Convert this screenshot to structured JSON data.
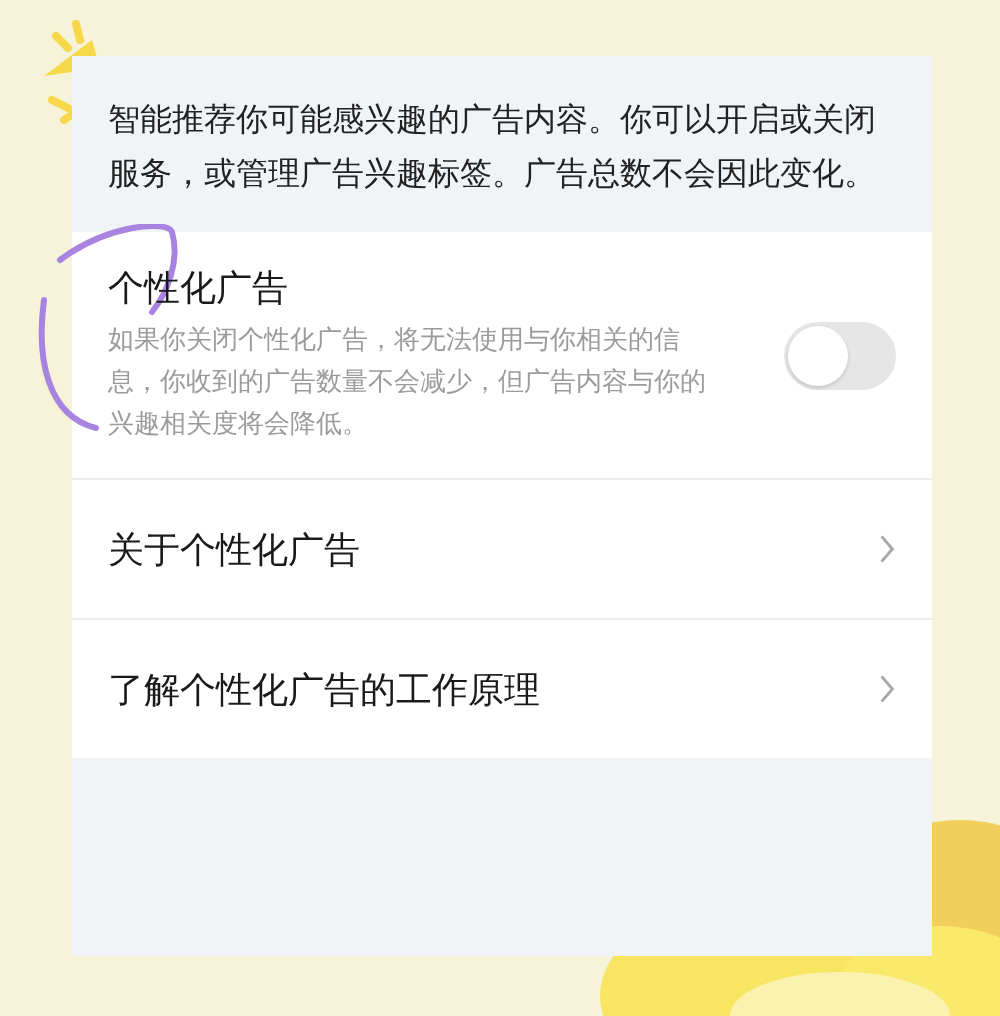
{
  "intro": "智能推荐你可能感兴趣的广告内容。你可以开启或关闭服务，或管理广告兴趣标签。广告总数不会因此变化。",
  "settings": [
    {
      "kind": "toggle",
      "title": "个性化广告",
      "description": "如果你关闭个性化广告，将无法使用与你相关的信息，你收到的广告数量不会减少，但广告内容与你的兴趣相关度将会降低。",
      "on": false
    },
    {
      "kind": "link",
      "title": "关于个性化广告"
    },
    {
      "kind": "link",
      "title": "了解个性化广告的工作原理"
    }
  ]
}
